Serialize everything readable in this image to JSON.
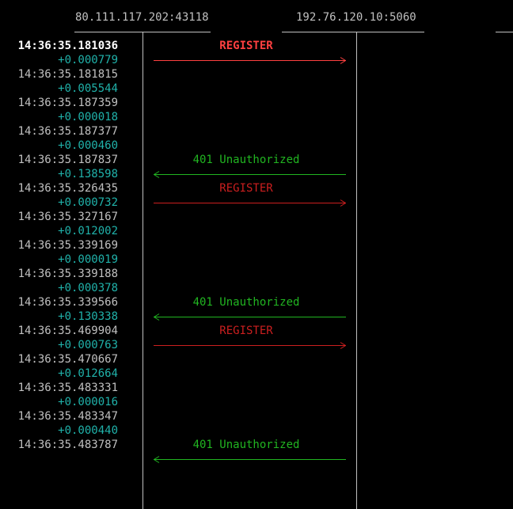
{
  "colors": {
    "background": "#000000",
    "text": "#c0c0c0",
    "bold_text": "#ffffff",
    "delta": "#20b2aa",
    "request_selected": "#ff4040",
    "request": "#cc1f1f",
    "response": "#21b521"
  },
  "hosts": {
    "left": "80.111.117.202:43118",
    "right": "192.76.120.10:5060"
  },
  "timestamps": [
    {
      "abs": "14:36:35.181036",
      "delta": "+0.000779",
      "bold": true
    },
    {
      "abs": "14:36:35.181815",
      "delta": "+0.005544",
      "bold": false
    },
    {
      "abs": "14:36:35.187359",
      "delta": "+0.000018",
      "bold": false
    },
    {
      "abs": "14:36:35.187377",
      "delta": "+0.000460",
      "bold": false
    },
    {
      "abs": "14:36:35.187837",
      "delta": "+0.138598",
      "bold": false
    },
    {
      "abs": "14:36:35.326435",
      "delta": "+0.000732",
      "bold": false
    },
    {
      "abs": "14:36:35.327167",
      "delta": "+0.012002",
      "bold": false
    },
    {
      "abs": "14:36:35.339169",
      "delta": "+0.000019",
      "bold": false
    },
    {
      "abs": "14:36:35.339188",
      "delta": "+0.000378",
      "bold": false
    },
    {
      "abs": "14:36:35.339566",
      "delta": "+0.130338",
      "bold": false
    },
    {
      "abs": "14:36:35.469904",
      "delta": "+0.000763",
      "bold": false
    },
    {
      "abs": "14:36:35.470667",
      "delta": "+0.012664",
      "bold": false
    },
    {
      "abs": "14:36:35.483331",
      "delta": "+0.000016",
      "bold": false
    },
    {
      "abs": "14:36:35.483347",
      "delta": "+0.000440",
      "bold": false
    },
    {
      "abs": "14:36:35.483787",
      "delta": "",
      "bold": false
    }
  ],
  "messages": [
    {
      "row": 0,
      "label": "REGISTER",
      "direction": "right",
      "kind": "request",
      "selected": true
    },
    {
      "row": 4,
      "label": "401 Unauthorized",
      "direction": "left",
      "kind": "response",
      "selected": false
    },
    {
      "row": 5,
      "label": "REGISTER",
      "direction": "right",
      "kind": "request",
      "selected": false
    },
    {
      "row": 9,
      "label": "401 Unauthorized",
      "direction": "left",
      "kind": "response",
      "selected": false
    },
    {
      "row": 10,
      "label": "REGISTER",
      "direction": "right",
      "kind": "request",
      "selected": false
    },
    {
      "row": 14,
      "label": "401 Unauthorized",
      "direction": "left",
      "kind": "response",
      "selected": false
    }
  ]
}
